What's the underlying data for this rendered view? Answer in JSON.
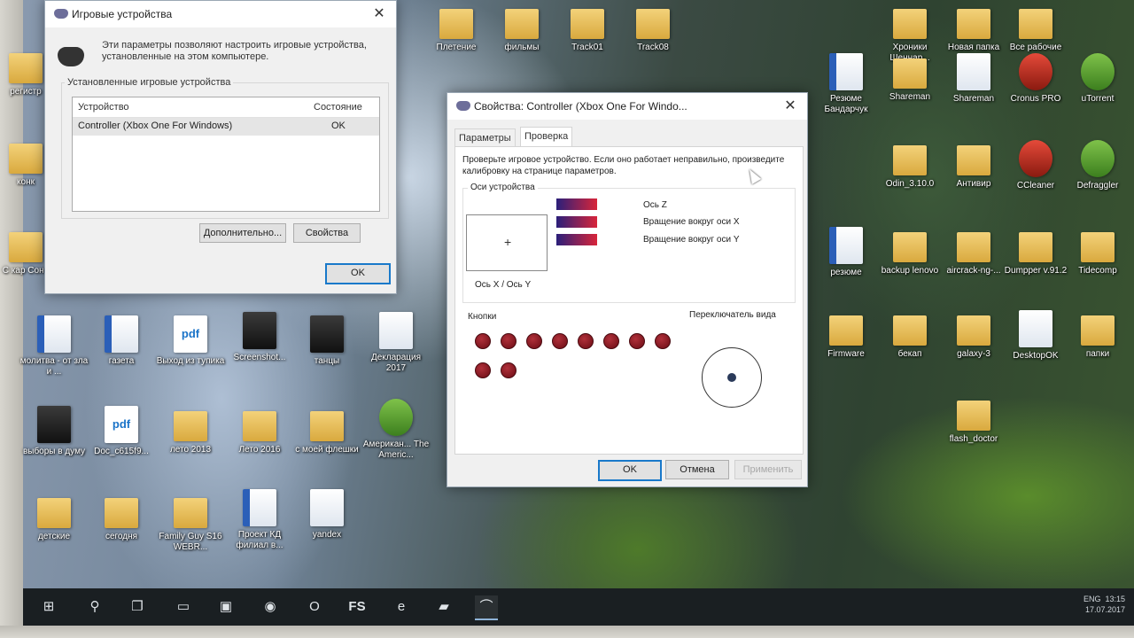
{
  "desktop": {
    "icons": [
      {
        "label": "Плетение",
        "type": "folder"
      },
      {
        "label": "фильмы",
        "type": "folder"
      },
      {
        "label": "Track01",
        "type": "folder"
      },
      {
        "label": "Track08",
        "type": "folder"
      },
      {
        "label": "Хроники Шеннар...",
        "type": "folder"
      },
      {
        "label": "Новая папка",
        "type": "folder"
      },
      {
        "label": "Все рабочие",
        "type": "folder"
      },
      {
        "label": "Резюме Бандарчук",
        "type": "word"
      },
      {
        "label": "Shareman",
        "type": "folder"
      },
      {
        "label": "Shareman",
        "type": "doc"
      },
      {
        "label": "Cronus PRO",
        "type": "red"
      },
      {
        "label": "uTorrent",
        "type": "green"
      },
      {
        "label": "Odin_3.10.0",
        "type": "folder"
      },
      {
        "label": "Антивир",
        "type": "folder"
      },
      {
        "label": "CCleaner",
        "type": "red"
      },
      {
        "label": "Defraggler",
        "type": "green"
      },
      {
        "label": "резюме",
        "type": "word"
      },
      {
        "label": "backup lenovo",
        "type": "folder"
      },
      {
        "label": "aircrack-ng-...",
        "type": "folder"
      },
      {
        "label": "Dumpper v.91.2",
        "type": "folder"
      },
      {
        "label": "Tidecomp",
        "type": "folder"
      },
      {
        "label": "Firmware",
        "type": "folder"
      },
      {
        "label": "бекап",
        "type": "folder"
      },
      {
        "label": "galaxy-3",
        "type": "folder"
      },
      {
        "label": "DesktopOK",
        "type": "doc"
      },
      {
        "label": "папки",
        "type": "folder"
      },
      {
        "label": "flash_doctor",
        "type": "folder"
      },
      {
        "label": "молитва - от зла и ...",
        "type": "word"
      },
      {
        "label": "газета",
        "type": "word"
      },
      {
        "label": "Выход из тупика",
        "type": "pdf"
      },
      {
        "label": "Screenshot...",
        "type": "dark"
      },
      {
        "label": "танцы",
        "type": "dark"
      },
      {
        "label": "Декларация 2017",
        "type": "doc"
      },
      {
        "label": "выборы в думу",
        "type": "dark"
      },
      {
        "label": "Doc_c615f9...",
        "type": "pdf"
      },
      {
        "label": "лето 2013",
        "type": "folder"
      },
      {
        "label": "Лето 2016",
        "type": "folder"
      },
      {
        "label": "с моей флешки",
        "type": "folder"
      },
      {
        "label": "Американ... The Americ...",
        "type": "green"
      },
      {
        "label": "детские",
        "type": "folder"
      },
      {
        "label": "сегодня",
        "type": "folder"
      },
      {
        "label": "Family Guy S16 WEBR...",
        "type": "folder"
      },
      {
        "label": "Проект КД филиал в...",
        "type": "word"
      },
      {
        "label": "yandex",
        "type": "doc"
      },
      {
        "label": "регистр",
        "type": "folder"
      },
      {
        "label": "конк",
        "type": "folder"
      },
      {
        "label": "С кар Сони",
        "type": "folder"
      }
    ]
  },
  "game_controllers": {
    "title": "Игровые устройства",
    "description": "Эти параметры позволяют настроить игровые устройства, установленные на этом компьютере.",
    "group_label": "Установленные игровые устройства",
    "columns": [
      "Устройство",
      "Состояние"
    ],
    "rows": [
      {
        "device": "Controller (Xbox One For Windows)",
        "status": "OK"
      }
    ],
    "advanced_label": "Дополнительно...",
    "properties_label": "Свойства",
    "ok_label": "OK"
  },
  "properties": {
    "title": "Свойства: Controller (Xbox One For Windo...",
    "tabs": [
      "Параметры",
      "Проверка"
    ],
    "active_tab": "Проверка",
    "description": "Проверьте игровое устройство. Если оно работает неправильно, произведите калибровку на странице параметров.",
    "axes_label": "Оси устройства",
    "xy_label": "Ось X / Ось Y",
    "axis_bars": [
      "Ось Z",
      "Вращение вокруг оси X",
      "Вращение вокруг оси Y"
    ],
    "buttons_label": "Кнопки",
    "button_count": 10,
    "pov_label": "Переключатель вида",
    "ok_label": "OK",
    "cancel_label": "Отмена",
    "apply_label": "Применить"
  },
  "taskbar": {
    "items": [
      "start",
      "search",
      "task-view",
      "file-explorer",
      "media-player",
      "chrome",
      "opera",
      "FS",
      "edge",
      "app",
      "game-controller"
    ],
    "fs_label": "FS",
    "tray_lang": "ENG",
    "time": "13:15",
    "date": "17.07.2017"
  }
}
